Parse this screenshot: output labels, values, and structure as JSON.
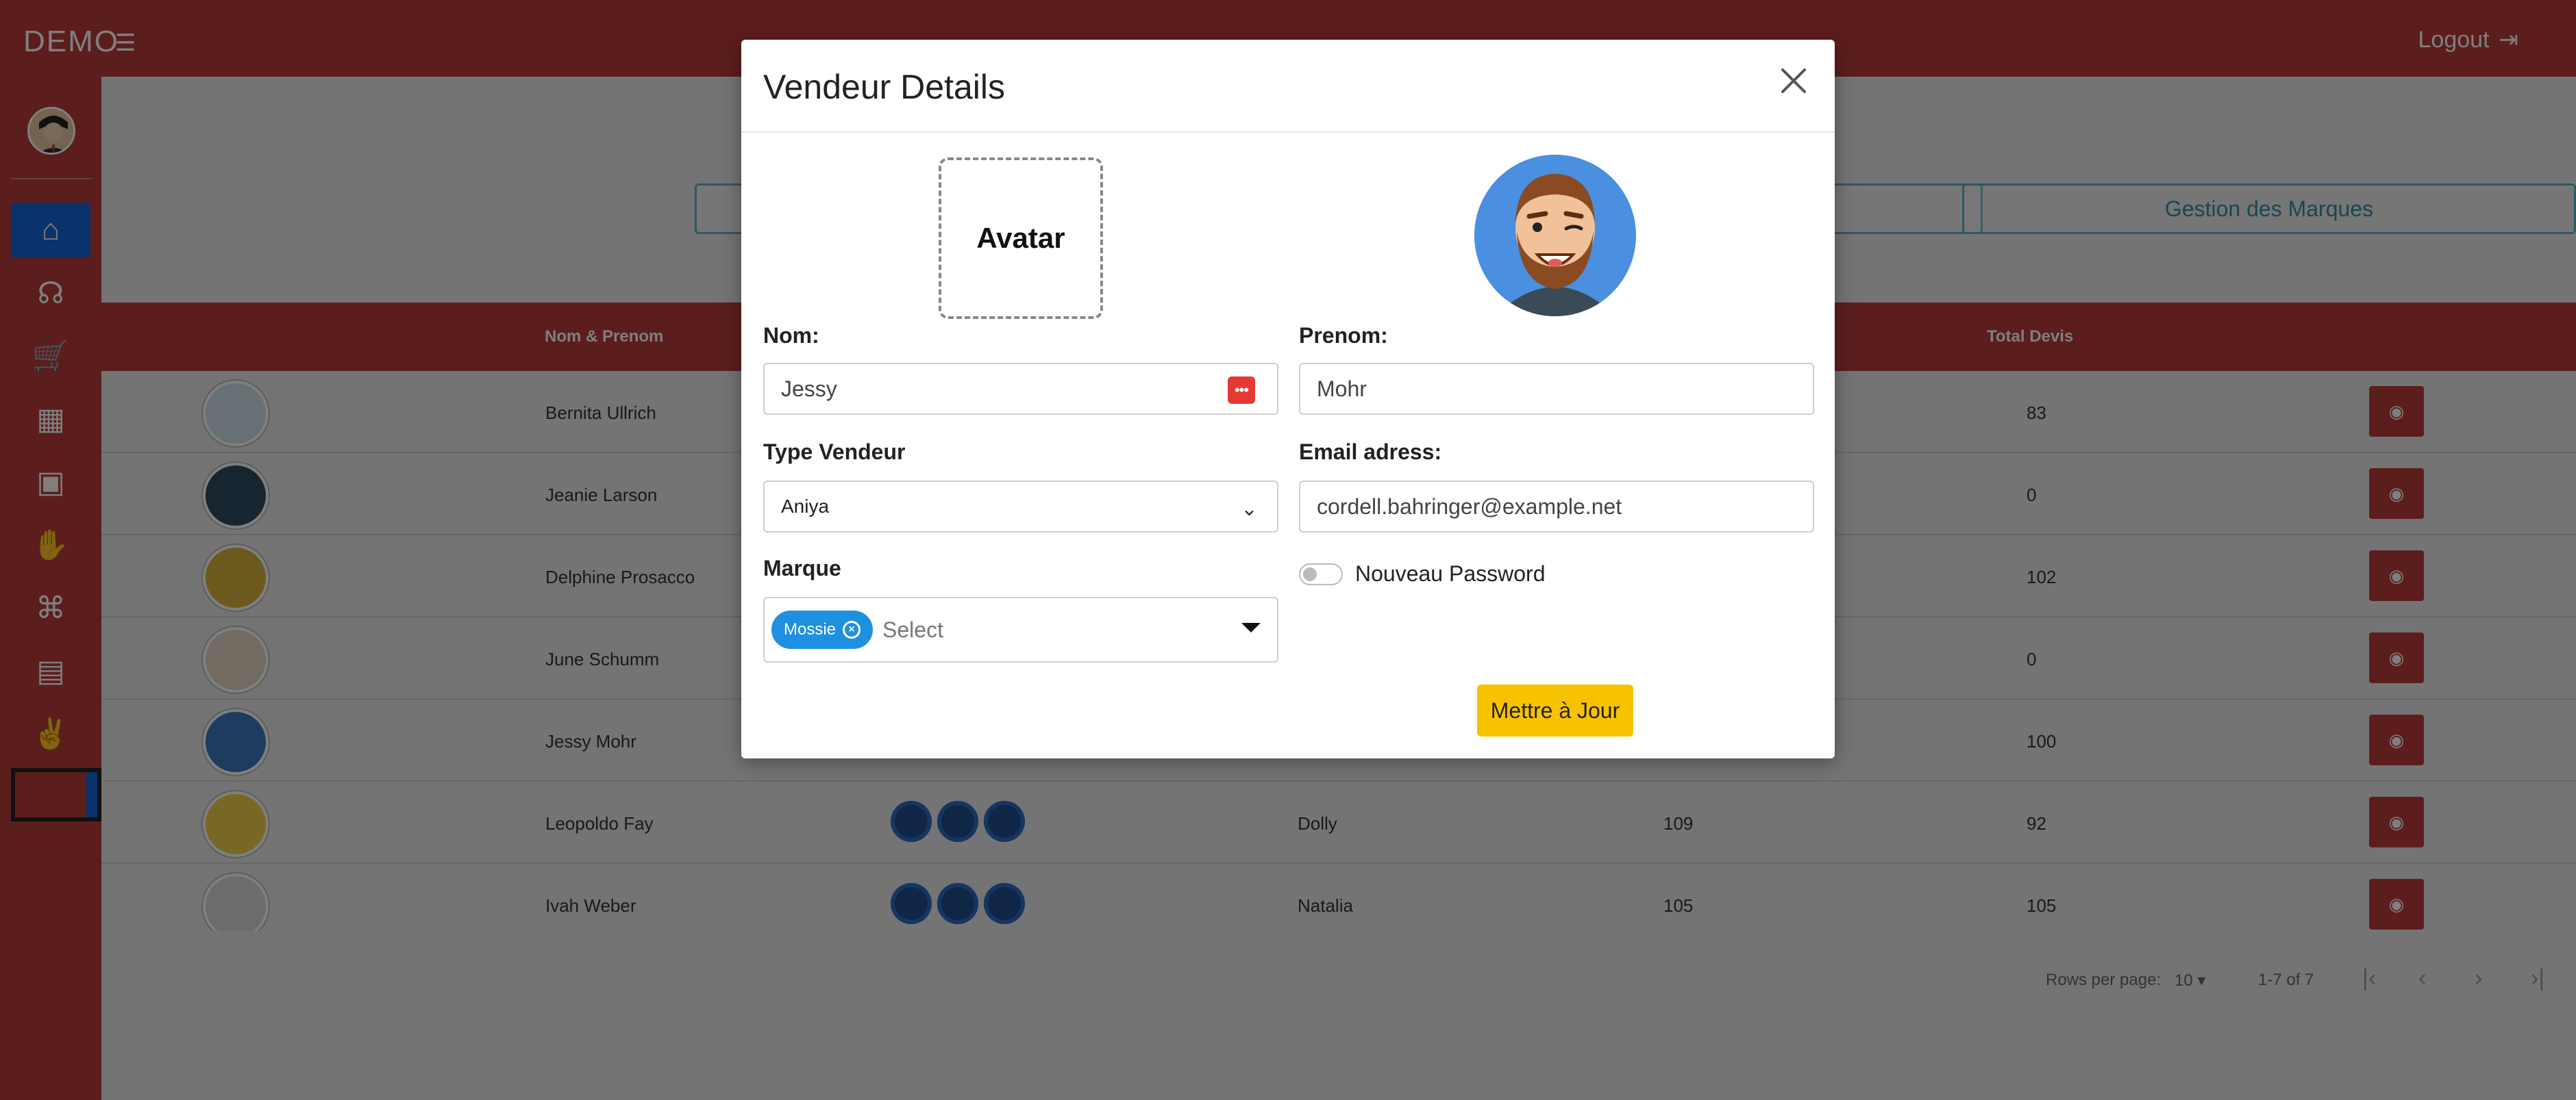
{
  "app": {
    "brand": "DEMO",
    "logout_label": "Logout"
  },
  "background_page": {
    "buttons": [
      "Gestion des Marques"
    ],
    "table_headers": {
      "name": "Nom & Prenom",
      "total": "Total Devis"
    },
    "rows": [
      {
        "name": "Bernita Ullrich",
        "type": "",
        "count": "",
        "total": "83"
      },
      {
        "name": "Jeanie Larson",
        "type": "",
        "count": "",
        "total": "0"
      },
      {
        "name": "Delphine Prosacco",
        "type": "",
        "count": "",
        "total": "102"
      },
      {
        "name": "June Schumm",
        "type": "",
        "count": "",
        "total": "0"
      },
      {
        "name": "Jessy Mohr",
        "type": "",
        "count": "",
        "total": "100"
      },
      {
        "name": "Leopoldo Fay",
        "type": "Dolly",
        "count": "109",
        "total": "92"
      },
      {
        "name": "Ivah Weber",
        "type": "Natalia",
        "count": "105",
        "total": "105"
      }
    ],
    "pagination": {
      "rows_per_page_label": "Rows per page:",
      "rows_per_page": "10",
      "range": "1-7 of 7"
    }
  },
  "modal": {
    "title": "Vendeur Details",
    "avatar_placeholder": "Avatar",
    "nom": {
      "label": "Nom:",
      "value": "Jessy"
    },
    "prenom": {
      "label": "Prenom:",
      "value": "Mohr"
    },
    "type_vendeur": {
      "label": "Type Vendeur",
      "value": "Aniya"
    },
    "email": {
      "label": "Email adress:",
      "value": "cordell.bahringer@example.net"
    },
    "marque": {
      "label": "Marque",
      "chips": [
        "Mossie"
      ],
      "placeholder": "Select"
    },
    "new_password": {
      "label": "Nouveau Password",
      "enabled": false
    },
    "submit_label": "Mettre à Jour"
  },
  "icons": [
    "menu-icon",
    "logout-icon",
    "home-icon",
    "headset-icon",
    "cart-icon",
    "ticket-icon",
    "contact-icon",
    "hand-coin-icon",
    "gift-icon",
    "building-icon",
    "handshake-icon",
    "eye-icon",
    "close-icon",
    "password-icon",
    "chevron-down-icon"
  ],
  "colors": {
    "primary_red": "#b93a3a",
    "active_blue": "#1565d8",
    "chip_blue": "#1e90e0",
    "submit_yellow": "#f7c300",
    "danger_icon": "#e53935"
  }
}
